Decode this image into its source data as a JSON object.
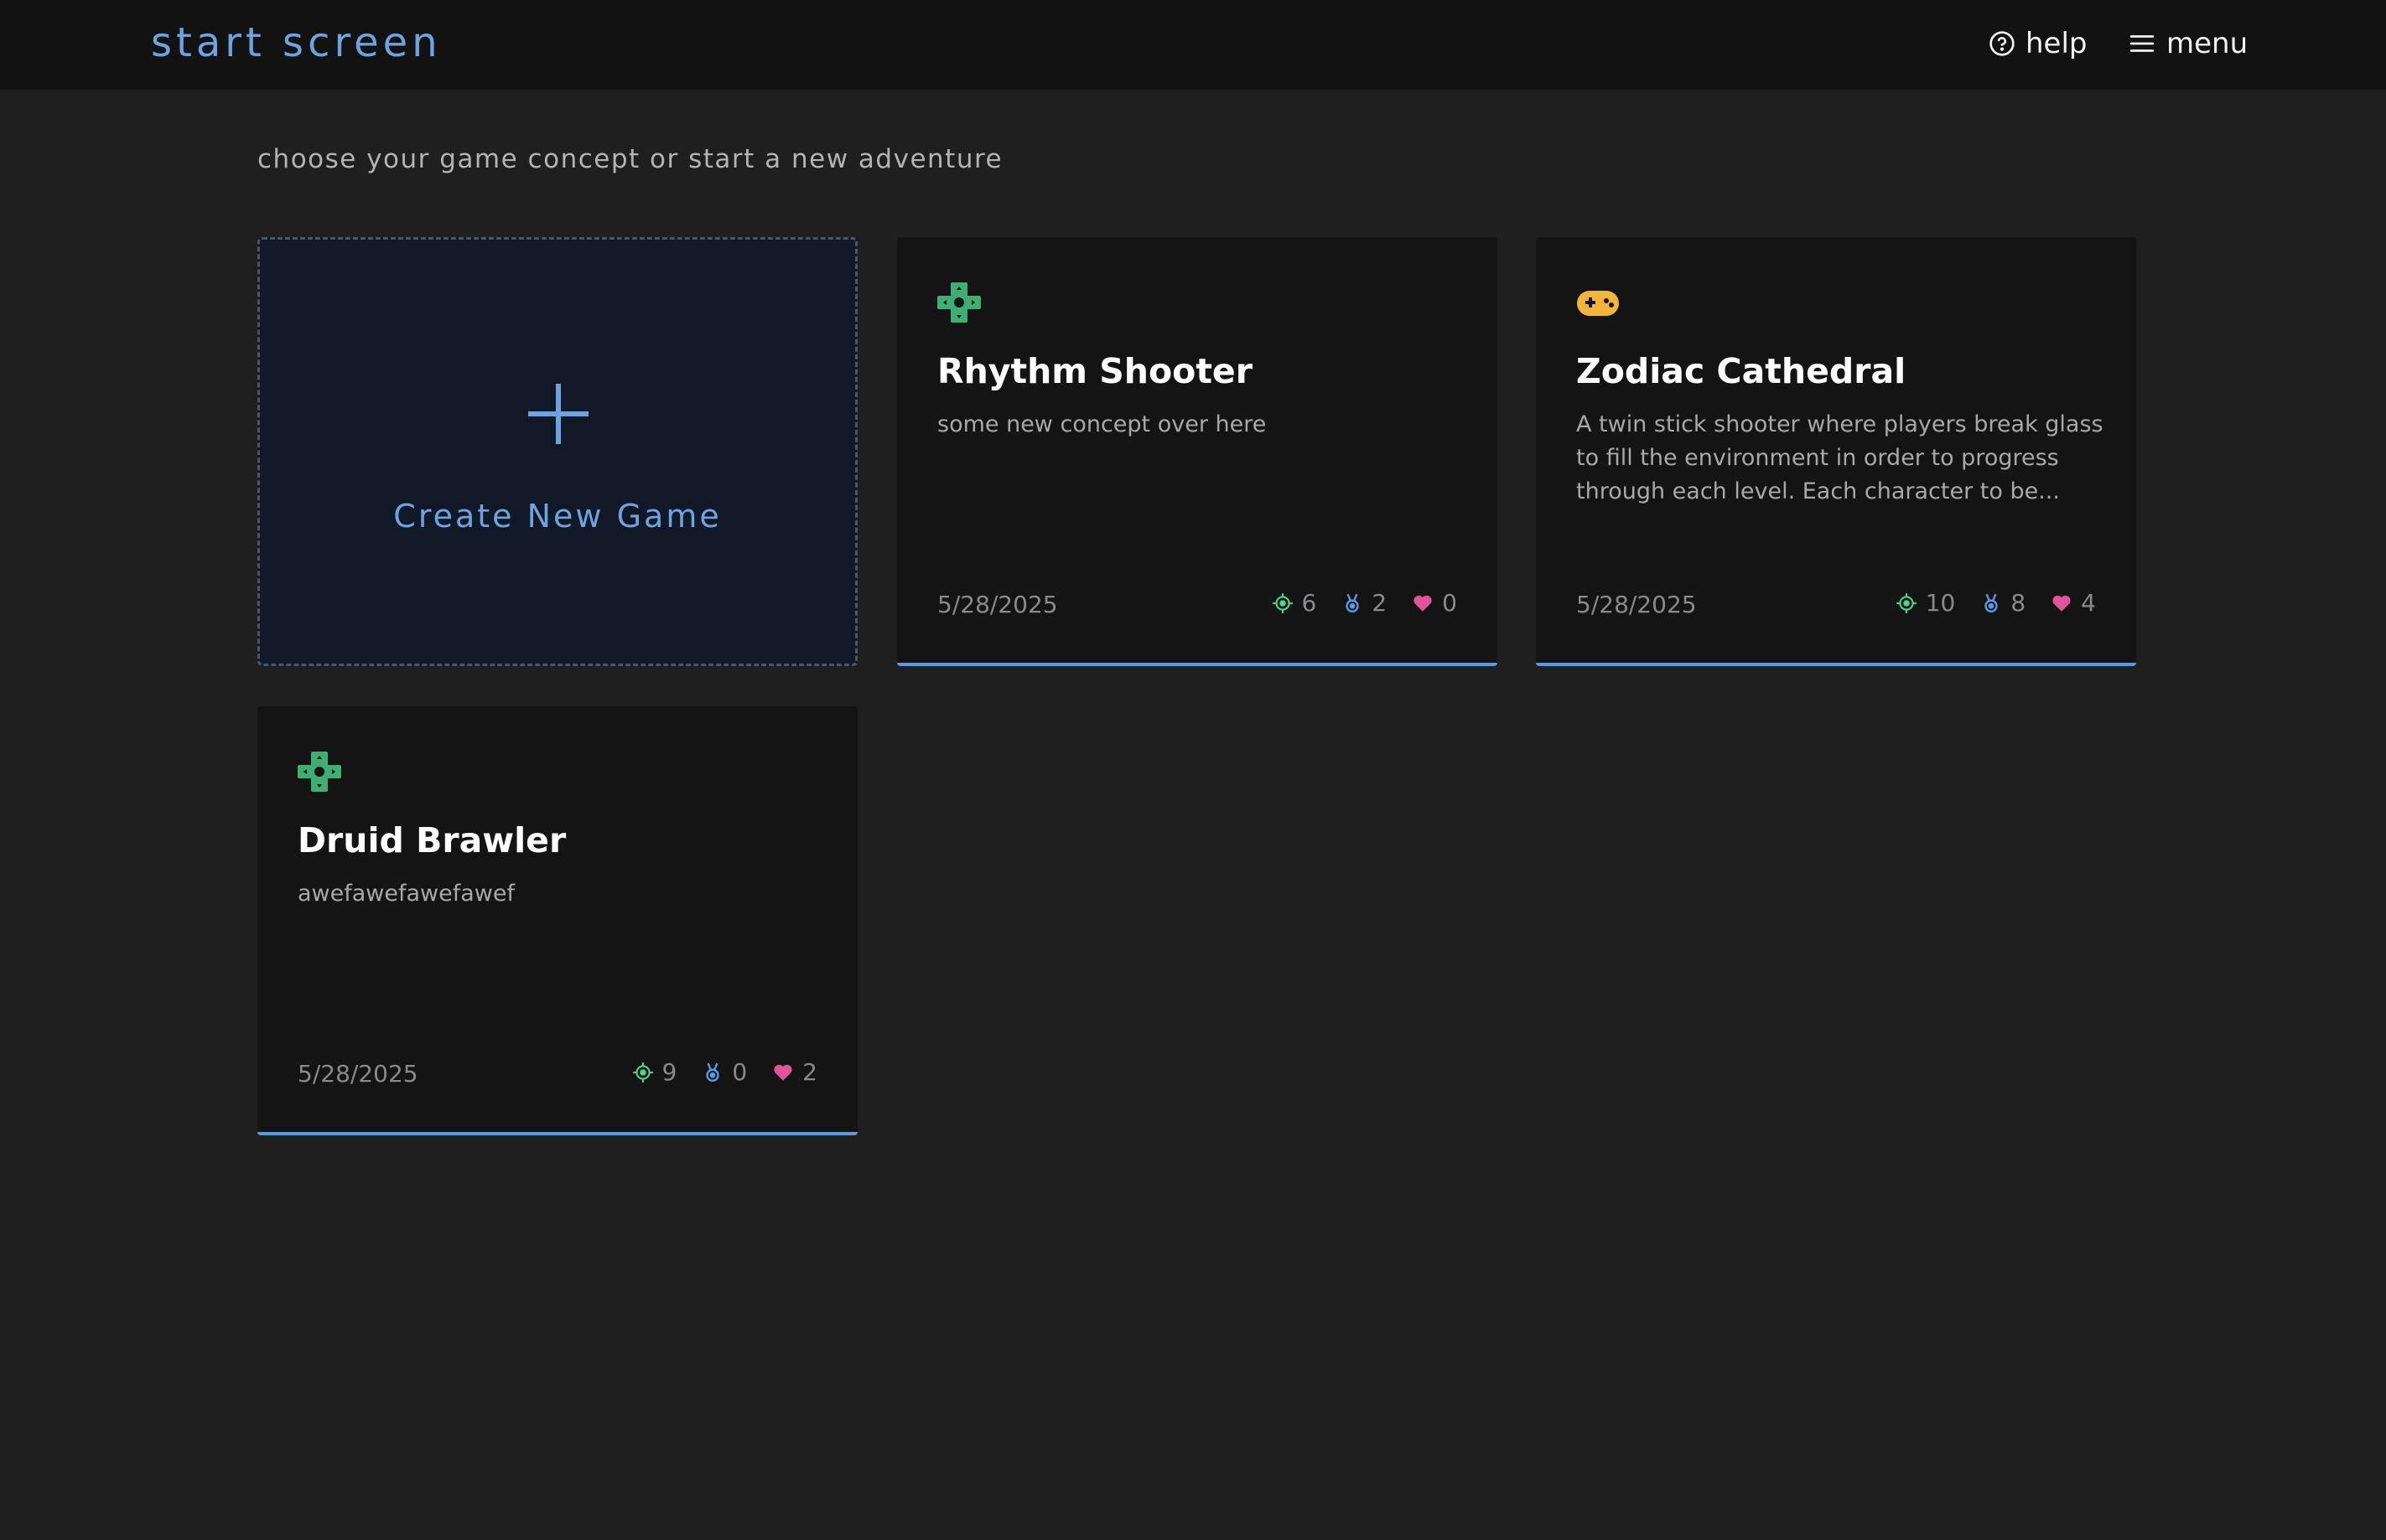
{
  "header": {
    "title": "start screen",
    "help_label": "help",
    "menu_label": "menu"
  },
  "subtitle": "choose your game concept or start a new adventure",
  "create_card": {
    "label": "Create New Game"
  },
  "colors": {
    "accent": "#5b9ae0",
    "target": "#4fd18b",
    "medal": "#5b9ae0",
    "heart": "#e0559a",
    "dpad": "#3fae72",
    "gamepad": "#f2b53a"
  },
  "games": [
    {
      "icon": "dpad-icon",
      "title": "Rhythm Shooter",
      "description": "some new concept over here",
      "date": "5/28/2025",
      "stats": {
        "targets": "6",
        "medals": "2",
        "likes": "0"
      }
    },
    {
      "icon": "gamepad-icon",
      "title": "Zodiac Cathedral",
      "description": "A twin stick shooter where players break glass to fill the environment in order to progress through each level. Each character to be...",
      "date": "5/28/2025",
      "stats": {
        "targets": "10",
        "medals": "8",
        "likes": "4"
      }
    },
    {
      "icon": "dpad-icon",
      "title": "Druid Brawler",
      "description": "awefawefawefawef",
      "date": "5/28/2025",
      "stats": {
        "targets": "9",
        "medals": "0",
        "likes": "2"
      }
    }
  ]
}
